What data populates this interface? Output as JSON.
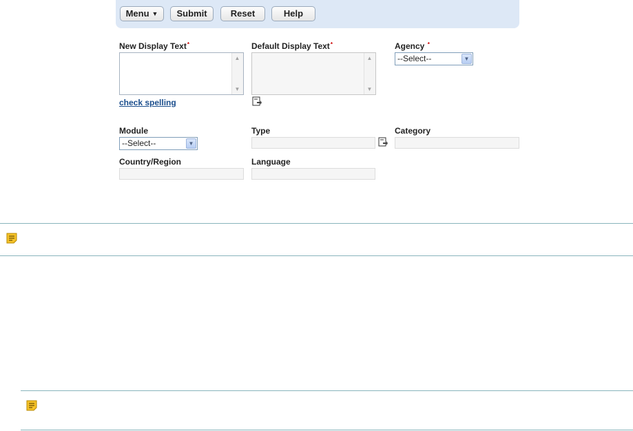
{
  "toolbar": {
    "menu_label": "Menu",
    "menu_caret": "▼",
    "submit_label": "Submit",
    "reset_label": "Reset",
    "help_label": "Help"
  },
  "form": {
    "new_display_text": {
      "label": "New Display Text",
      "required_mark": "*",
      "value": ""
    },
    "default_display_text": {
      "label": "Default Display Text",
      "required_mark": "*",
      "value": ""
    },
    "agency": {
      "label": "Agency",
      "required_mark": "*",
      "selected": "--Select--"
    },
    "check_spelling": "check spelling",
    "module": {
      "label": "Module",
      "selected": "--Select--"
    },
    "type": {
      "label": "Type",
      "value": ""
    },
    "category": {
      "label": "Category",
      "value": ""
    },
    "country_region": {
      "label": "Country/Region",
      "value": ""
    },
    "language": {
      "label": "Language",
      "value": ""
    }
  },
  "colors": {
    "toolbar_bg": "#dde8f6",
    "link": "#1a4d8c",
    "required": "#cc0000",
    "note_icon": "#f5c229",
    "divider": "#88b4bc"
  },
  "icons": [
    "note-icon",
    "document-lookup-icon",
    "chevron-down-icon"
  ]
}
